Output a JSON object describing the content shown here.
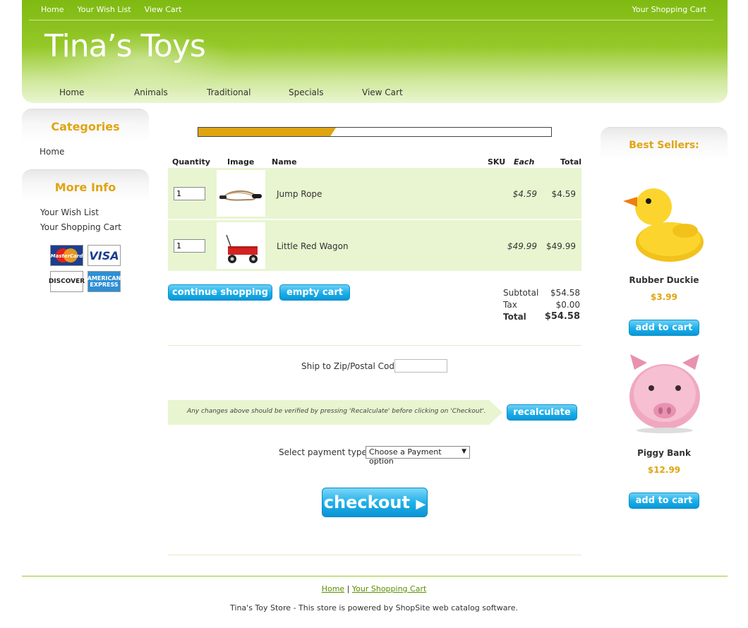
{
  "header": {
    "top_nav": [
      "Home",
      "Your Wish List",
      "View Cart"
    ],
    "top_right": "Your Shopping Cart",
    "logo": "Tina’s Toys",
    "main_nav": [
      "Home",
      "Animals",
      "Traditional",
      "Specials",
      "View Cart"
    ]
  },
  "sidebar": {
    "categories_title": "Categories",
    "categories": [
      "Home"
    ],
    "more_info_title": "More Info",
    "more_info": [
      "Your Wish List",
      "Your Shopping Cart"
    ],
    "cards": [
      "MasterCard",
      "VISA",
      "DISCOVER",
      "AMERICAN EXPRESS"
    ]
  },
  "progress": {
    "fraction": 0.39,
    "color": "#e0a411"
  },
  "cart": {
    "headers": {
      "quantity": "Quantity",
      "image": "Image",
      "name": "Name",
      "sku": "SKU",
      "each": "Each",
      "total": "Total"
    },
    "items": [
      {
        "qty": "1",
        "name": "Jump Rope",
        "each": "$4.59",
        "total": "$4.59"
      },
      {
        "qty": "1",
        "name": "Little Red Wagon",
        "each": "$49.99",
        "total": "$49.99"
      }
    ],
    "continue_label": "continue shopping",
    "empty_label": "empty cart",
    "subtotal_label": "Subtotal",
    "subtotal": "$54.58",
    "tax_label": "Tax",
    "tax": "$0.00",
    "total_label": "Total",
    "total": "$54.58"
  },
  "shipping": {
    "zip_label": "Ship to Zip/Postal Code",
    "zip_value": ""
  },
  "notice": {
    "text": "Any changes above should be verified by pressing 'Recalculate' before clicking on 'Checkout'.",
    "recalc_label": "recalculate"
  },
  "payment": {
    "label": "Select payment type:",
    "selected": "Choose a Payment option"
  },
  "checkout_label": "checkout",
  "best_sellers": {
    "title": "Best Sellers:",
    "items": [
      {
        "name": "Rubber Duckie",
        "price": "$3.99",
        "button": "add to cart"
      },
      {
        "name": "Piggy Bank",
        "price": "$12.99",
        "button": "add to cart"
      }
    ]
  },
  "footer": {
    "links": [
      "Home",
      "Your Shopping Cart"
    ],
    "separator": "|",
    "text": "Tina's Toy Store - This store is powered by ShopSite web catalog software."
  }
}
